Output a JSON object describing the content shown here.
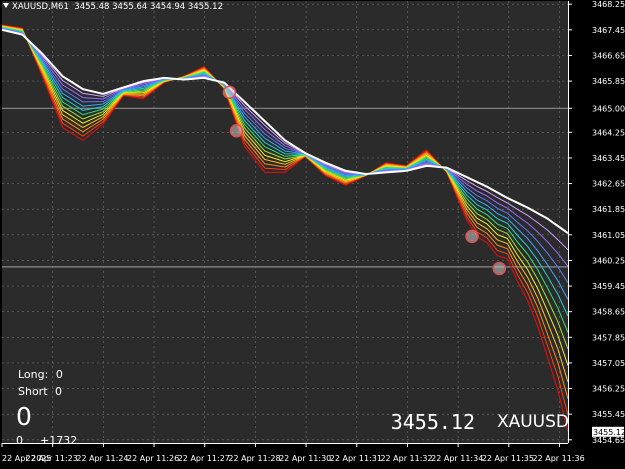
{
  "header": {
    "symbol_period": "XAUUSD,M61",
    "ohlc": "3455.48 3455.64 3454.94 3455.12"
  },
  "colors": {
    "background": "#000000",
    "plot_background": "#2b2b2b",
    "grid": "#707070",
    "price_line": "#c01010",
    "signal_line": "#ffffff",
    "horizontal_level": "#8a8a8a",
    "ribbon": [
      "#ffffff",
      "#d0a0ff",
      "#9a6cff",
      "#5a7cff",
      "#3aa8ff",
      "#20d0d0",
      "#30e070",
      "#a0e030",
      "#f0f020",
      "#ffc020",
      "#ff8a10",
      "#ff4010",
      "#d01010"
    ],
    "marker": "#e05050",
    "axis_text": "#ffffff"
  },
  "hud": {
    "long_label": "Long:",
    "long_value": "0",
    "short_label": "Short",
    "short_value": "0",
    "big_value": "0",
    "bottom_left": "0",
    "bottom_count": "+1732",
    "price_display": "3455.12",
    "symbol_display": "XAUUSD"
  },
  "price_tag": "3455.12",
  "chart_data": {
    "type": "line",
    "title": "XAUUSD,M61 3455.48 3455.64 3454.94 3455.12",
    "y_ticks": [
      3468.25,
      3467.45,
      3466.65,
      3465.85,
      3465.0,
      3464.25,
      3463.45,
      3462.65,
      3461.85,
      3461.05,
      3460.25,
      3459.45,
      3458.65,
      3457.85,
      3457.05,
      3456.25,
      3455.45,
      3454.65
    ],
    "ylim": [
      3454.55,
      3468.35
    ],
    "x_ticks": [
      "22 Apr 2025",
      "22 Apr 11:23",
      "22 Apr 11:24",
      "22 Apr 11:26",
      "22 Apr 11:27",
      "22 Apr 11:28",
      "22 Apr 11:30",
      "22 Apr 11:31",
      "22 Apr 11:32",
      "22 Apr 11:34",
      "22 Apr 11:35",
      "22 Apr 11:36"
    ],
    "x_range": [
      0,
      56
    ],
    "horizontal_levels": [
      3465.0,
      3460.05
    ],
    "series": [
      {
        "role": "price",
        "x": [
          0,
          2,
          4,
          6,
          8,
          10,
          12,
          14,
          16,
          18,
          20,
          22,
          24,
          26,
          28,
          30,
          32,
          34,
          36,
          38,
          40,
          42,
          44,
          46,
          47,
          48,
          49,
          50,
          51,
          52,
          53,
          54,
          55,
          56
        ],
        "values": [
          3467.6,
          3467.5,
          3466.0,
          3464.4,
          3464.0,
          3464.5,
          3465.4,
          3465.3,
          3465.8,
          3466.0,
          3466.3,
          3465.6,
          3463.8,
          3463.0,
          3463.0,
          3463.5,
          3462.9,
          3462.6,
          3462.9,
          3463.3,
          3463.2,
          3463.7,
          3463.0,
          3461.5,
          3461.0,
          3460.8,
          3460.4,
          3460.3,
          3459.6,
          3459.0,
          3458.2,
          3457.2,
          3456.2,
          3454.9
        ]
      },
      {
        "role": "signal",
        "x": [
          0,
          2,
          4,
          6,
          8,
          10,
          12,
          14,
          16,
          18,
          20,
          22,
          24,
          26,
          28,
          30,
          32,
          34,
          36,
          38,
          40,
          42,
          44,
          46,
          48,
          50,
          52,
          54,
          56
        ],
        "values": [
          3467.45,
          3467.3,
          3466.7,
          3466.0,
          3465.6,
          3465.45,
          3465.65,
          3465.85,
          3465.95,
          3465.9,
          3465.95,
          3465.8,
          3465.2,
          3464.6,
          3464.0,
          3463.6,
          3463.3,
          3463.05,
          3462.95,
          3463.0,
          3463.05,
          3463.2,
          3463.15,
          3462.85,
          3462.55,
          3462.2,
          3461.9,
          3461.55,
          3461.1
        ]
      }
    ],
    "markers": [
      {
        "x": 22.5,
        "y": 3465.5
      },
      {
        "x": 23.2,
        "y": 3464.3
      },
      {
        "x": 46.5,
        "y": 3461.0
      },
      {
        "x": 49.2,
        "y": 3460.0
      }
    ]
  }
}
